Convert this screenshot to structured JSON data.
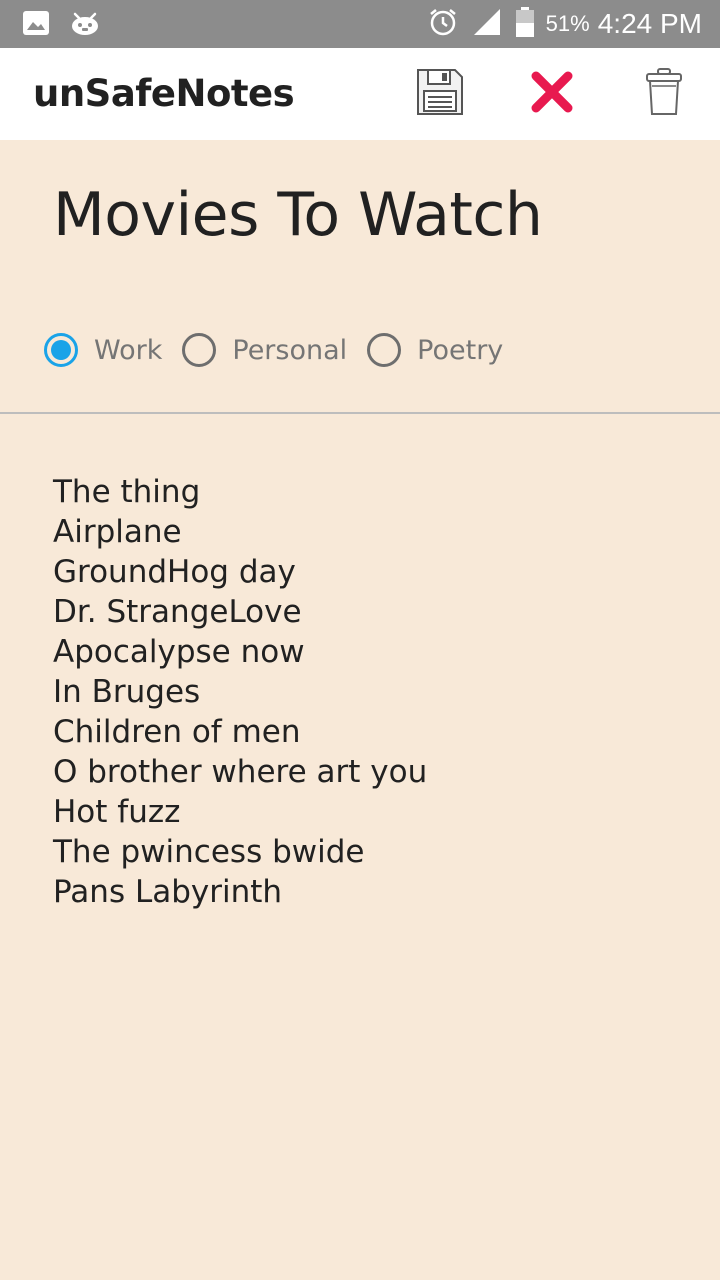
{
  "status_bar": {
    "battery_percent": "51%",
    "time": "4:24 PM",
    "icons": [
      "image-icon",
      "android-debug-icon",
      "alarm-icon",
      "signal-icon",
      "battery-icon"
    ]
  },
  "app_bar": {
    "title": "unSafeNotes",
    "actions": [
      "save-icon",
      "close-icon",
      "trash-icon"
    ],
    "close_color": "#e8194f"
  },
  "note": {
    "title": "Movies To Watch",
    "categories": [
      {
        "label": "Work",
        "checked": true
      },
      {
        "label": "Personal",
        "checked": false
      },
      {
        "label": "Poetry",
        "checked": false
      }
    ],
    "accent_color": "#1aa3e8",
    "lines": [
      "The thing",
      "Airplane",
      "GroundHog day",
      "Dr. StrangeLove",
      "Apocalypse now",
      "In Bruges",
      "Children of men",
      "O brother where art you",
      "Hot fuzz",
      "The pwincess bwide",
      "Pans Labyrinth"
    ]
  },
  "background_color": "#f8e9d8"
}
